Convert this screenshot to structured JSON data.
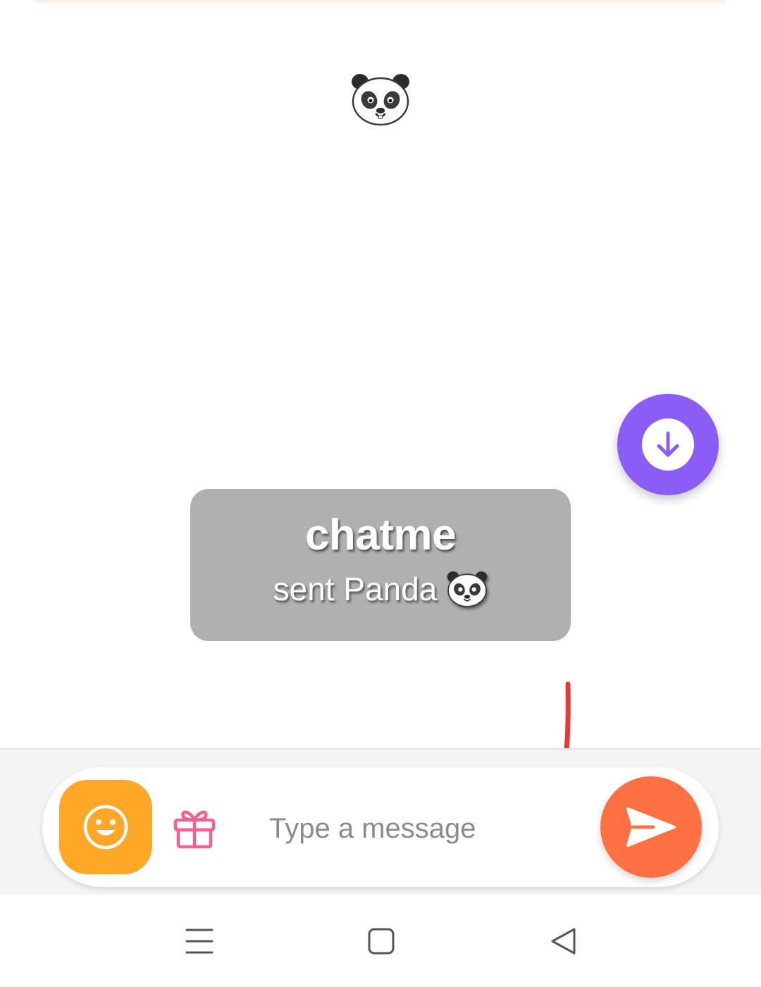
{
  "chat": {
    "sticker": {
      "name": "Panda",
      "icon": "panda-icon"
    },
    "gift_notice": {
      "sender": "chatme",
      "action": "sent Panda"
    }
  },
  "scroll_button": {
    "icon": "arrow-down-icon",
    "color": "#8b5cf6"
  },
  "composer": {
    "placeholder": "Type a message",
    "value": "",
    "emoji_icon": "smiley-icon",
    "emoji_color": "#ffa726",
    "gift_icon": "gift-icon",
    "gift_color": "#f06292",
    "send_icon": "send-icon",
    "send_color": "#ff7043"
  },
  "navigation": {
    "items": [
      "menu-icon",
      "home-square-icon",
      "back-triangle-icon"
    ]
  }
}
